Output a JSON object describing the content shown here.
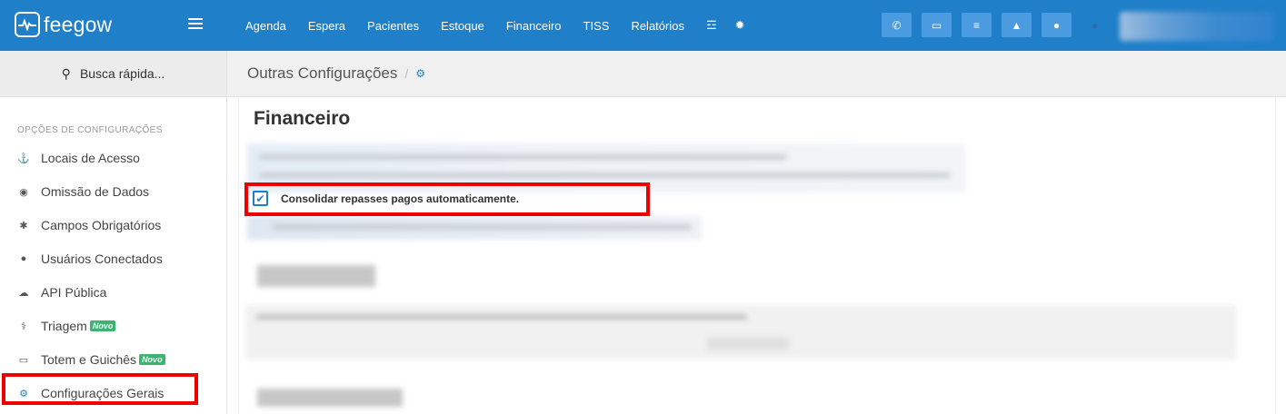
{
  "app": {
    "logo_text": "feegow"
  },
  "nav": [
    "Agenda",
    "Espera",
    "Pacientes",
    "Estoque",
    "Financeiro",
    "TISS",
    "Relatórios"
  ],
  "nav_icons": [
    "database-icon",
    "gear-icon"
  ],
  "toolbar_buttons": [
    "phone-icon",
    "inbox-icon",
    "list-icon",
    "bell-icon",
    "chat-icon"
  ],
  "sidebar": {
    "search_label": "Busca rápida...",
    "section_title": "OPÇÕES DE CONFIGURAÇÕES",
    "items": [
      {
        "label": "Locais de Acesso",
        "icon": "location-icon",
        "glyph": "⚓"
      },
      {
        "label": "Omissão de Dados",
        "icon": "eye-slash-icon",
        "glyph": "◉"
      },
      {
        "label": "Campos Obrigatórios",
        "icon": "asterisk-icon",
        "glyph": "✱"
      },
      {
        "label": "Usuários Conectados",
        "icon": "user-icon",
        "glyph": "●"
      },
      {
        "label": "API Pública",
        "icon": "cloud-icon",
        "glyph": "☁"
      },
      {
        "label": "Triagem",
        "icon": "stethoscope-icon",
        "glyph": "⚕",
        "badge": "Novo"
      },
      {
        "label": "Totem e Guichês",
        "icon": "laptop-icon",
        "glyph": "▭",
        "badge": "Novo"
      },
      {
        "label": "Configurações Gerais",
        "icon": "gears-icon",
        "glyph": "⚙"
      }
    ]
  },
  "breadcrumb": {
    "title": "Outras Configurações",
    "separator": "/"
  },
  "main": {
    "section_title": "Financeiro",
    "checkbox_label": "Consolidar repasses pagos automaticamente.",
    "checkbox_checked": true
  },
  "colors": {
    "topbar": "#1f7fc8",
    "highlight": "#e00000",
    "badge": "#3cb371"
  }
}
